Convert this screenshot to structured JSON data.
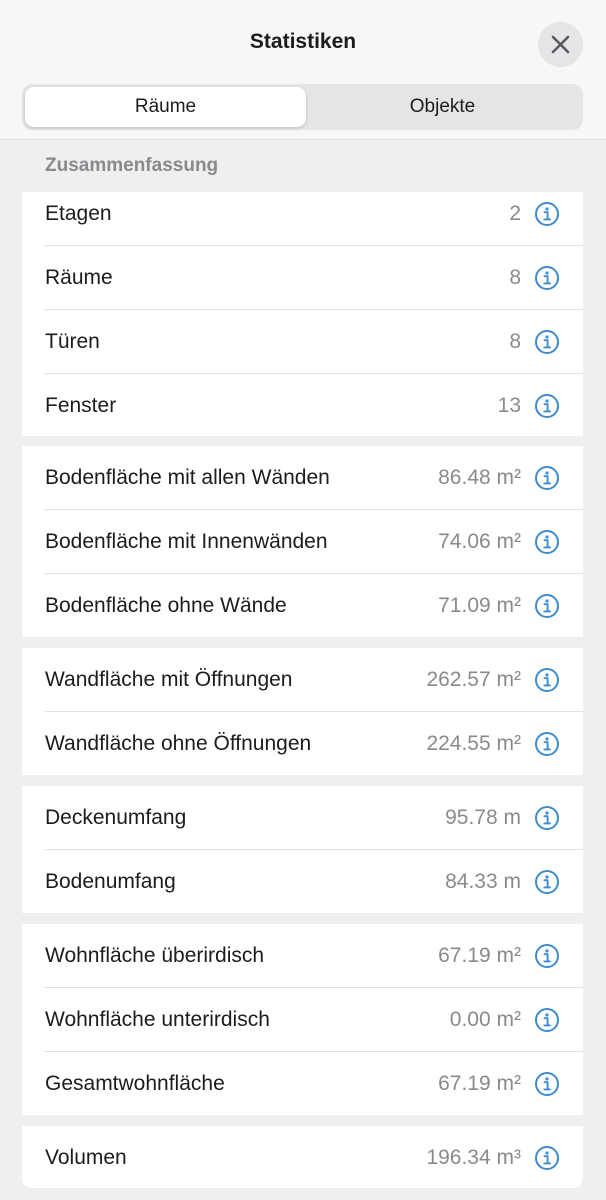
{
  "header": {
    "title": "Statistiken",
    "close_icon": "close-icon"
  },
  "segmented": {
    "tabs": [
      {
        "label": "Räume",
        "selected": true
      },
      {
        "label": "Objekte",
        "selected": false
      }
    ]
  },
  "section": {
    "title": "Zusammenfassung"
  },
  "groups": [
    {
      "rows": [
        {
          "label": "Etagen",
          "value": "2"
        },
        {
          "label": "Räume",
          "value": "8"
        },
        {
          "label": "Türen",
          "value": "8"
        },
        {
          "label": "Fenster",
          "value": "13"
        }
      ]
    },
    {
      "rows": [
        {
          "label": "Bodenfläche mit allen Wänden",
          "value": "86.48 m²"
        },
        {
          "label": "Bodenfläche mit Innenwänden",
          "value": "74.06 m²"
        },
        {
          "label": "Bodenfläche ohne Wände",
          "value": "71.09 m²"
        }
      ]
    },
    {
      "rows": [
        {
          "label": "Wandfläche mit Öffnungen",
          "value": "262.57 m²"
        },
        {
          "label": "Wandfläche ohne Öffnungen",
          "value": "224.55 m²"
        }
      ]
    },
    {
      "rows": [
        {
          "label": "Deckenumfang",
          "value": "95.78 m"
        },
        {
          "label": "Bodenumfang",
          "value": "84.33 m"
        }
      ]
    },
    {
      "rows": [
        {
          "label": "Wohnfläche überirdisch",
          "value": "67.19 m²"
        },
        {
          "label": "Wohnfläche unterirdisch",
          "value": "0.00 m²"
        },
        {
          "label": "Gesamtwohnfläche",
          "value": "67.19 m²"
        }
      ]
    },
    {
      "rows": [
        {
          "label": "Volumen",
          "value": "196.34 m³"
        }
      ]
    }
  ],
  "colors": {
    "accent": "#3d8ccf",
    "background": "#efefef",
    "secondary_text": "#8a8a8e"
  }
}
